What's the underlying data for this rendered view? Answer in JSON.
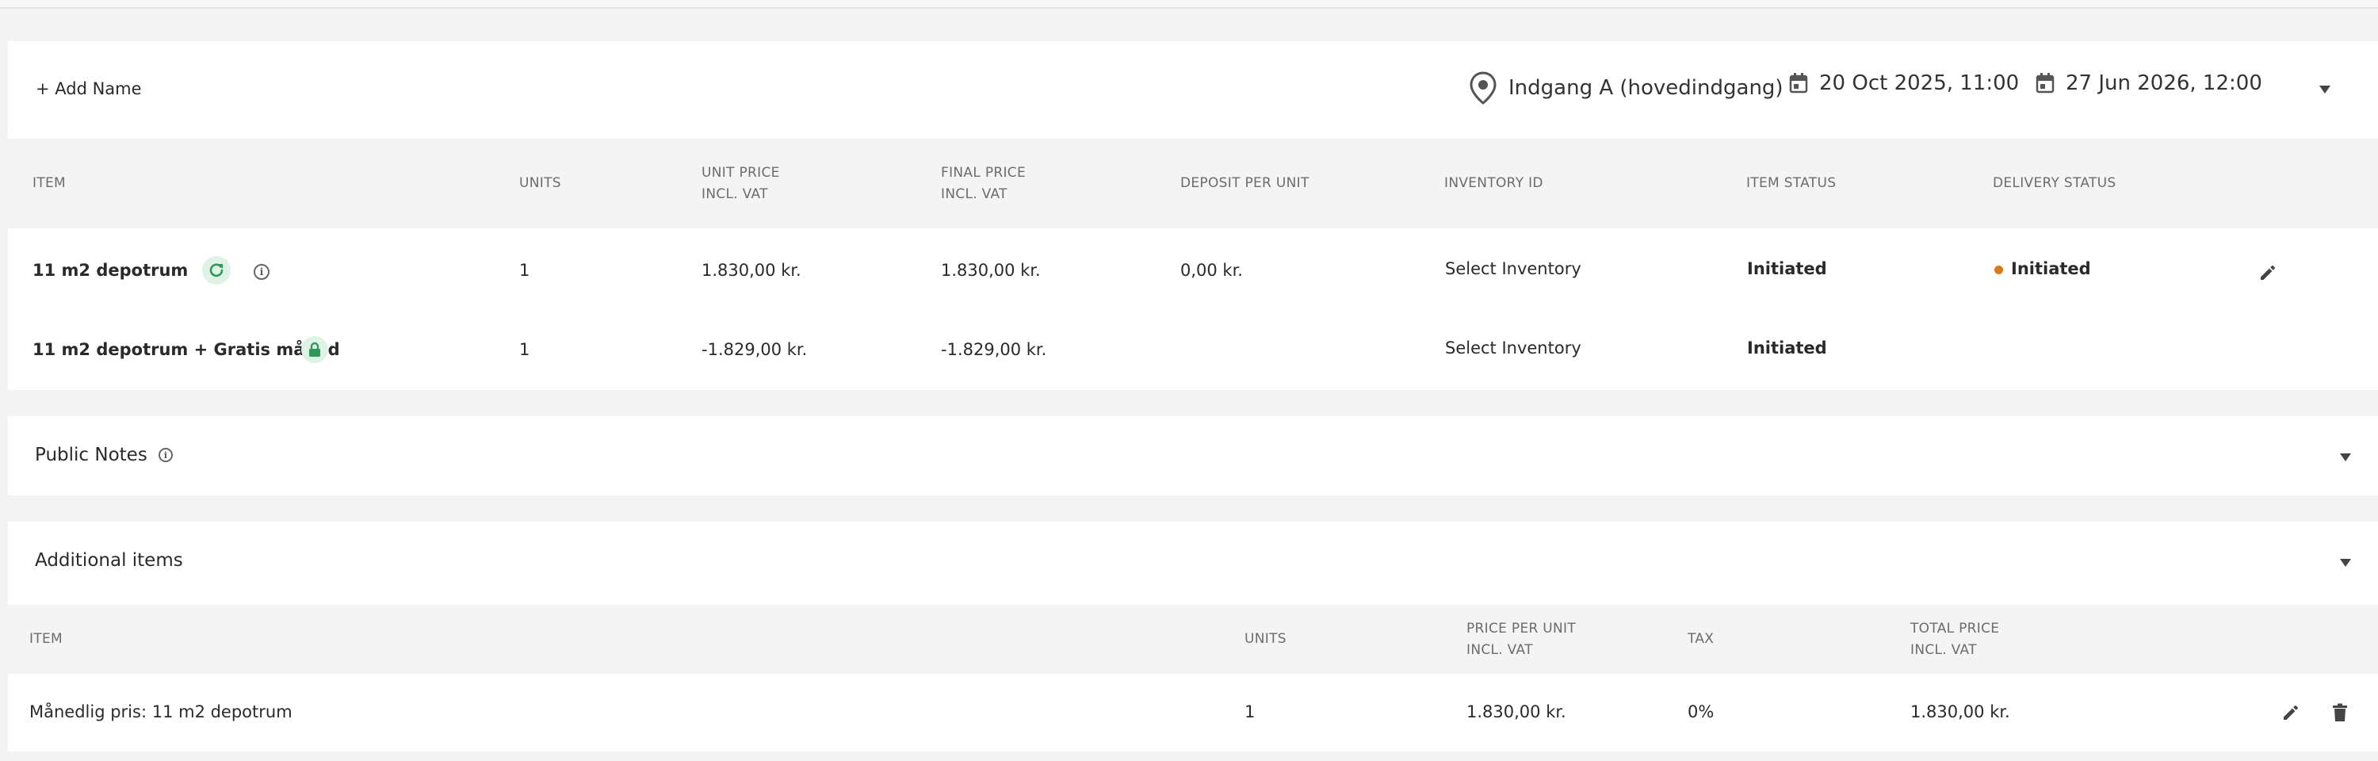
{
  "header": {
    "add_name_label": "+ Add Name",
    "location": "Indgang A (hovedindgang)",
    "start_date": "20 Oct 2025, 11:00",
    "end_date": "27 Jun 2026, 12:00"
  },
  "items_table": {
    "columns": {
      "item": "ITEM",
      "units": "UNITS",
      "unit_price_1": "UNIT PRICE",
      "unit_price_2": "INCL. VAT",
      "final_price_1": "FINAL PRICE",
      "final_price_2": "INCL. VAT",
      "deposit": "DEPOSIT PER UNIT",
      "inventory": "INVENTORY ID",
      "item_status": "ITEM STATUS",
      "delivery_status": "DELIVERY STATUS"
    },
    "rows": [
      {
        "item": "11 m2 depotrum",
        "units": "1",
        "unit_price": "1.830,00 kr.",
        "final_price": "1.830,00 kr.",
        "deposit": "0,00 kr.",
        "inventory": "Select Inventory",
        "item_status": "Initiated",
        "delivery_status": "Initiated"
      },
      {
        "item": "11 m2 depotrum + Gratis måned",
        "units": "1",
        "unit_price": "-1.829,00 kr.",
        "final_price": "-1.829,00 kr.",
        "deposit": "",
        "inventory": "Select Inventory",
        "item_status": "Initiated",
        "delivery_status": ""
      }
    ]
  },
  "public_notes": {
    "title": "Public Notes"
  },
  "additional_items": {
    "title": "Additional items",
    "columns": {
      "item": "ITEM",
      "units": "UNITS",
      "price_1": "PRICE PER UNIT",
      "price_2": "INCL. VAT",
      "tax": "TAX",
      "total_1": "TOTAL PRICE",
      "total_2": "INCL. VAT"
    },
    "rows": [
      {
        "item": "Månedlig pris: 11 m2 depotrum",
        "units": "1",
        "price": "1.830,00 kr.",
        "tax": "0%",
        "total": "1.830,00 kr."
      }
    ]
  },
  "icons": {
    "location": "map-pin-icon",
    "calendar": "calendar-icon",
    "recurring": "refresh-icon",
    "lock": "lock-icon",
    "info": "info-icon",
    "edit": "pencil-icon",
    "delete": "trash-icon",
    "collapse": "caret-down-icon"
  },
  "colors": {
    "green_chip": "#dff2e6",
    "green_icon": "#2e9a5a",
    "status_dot": "#d97a1a"
  }
}
